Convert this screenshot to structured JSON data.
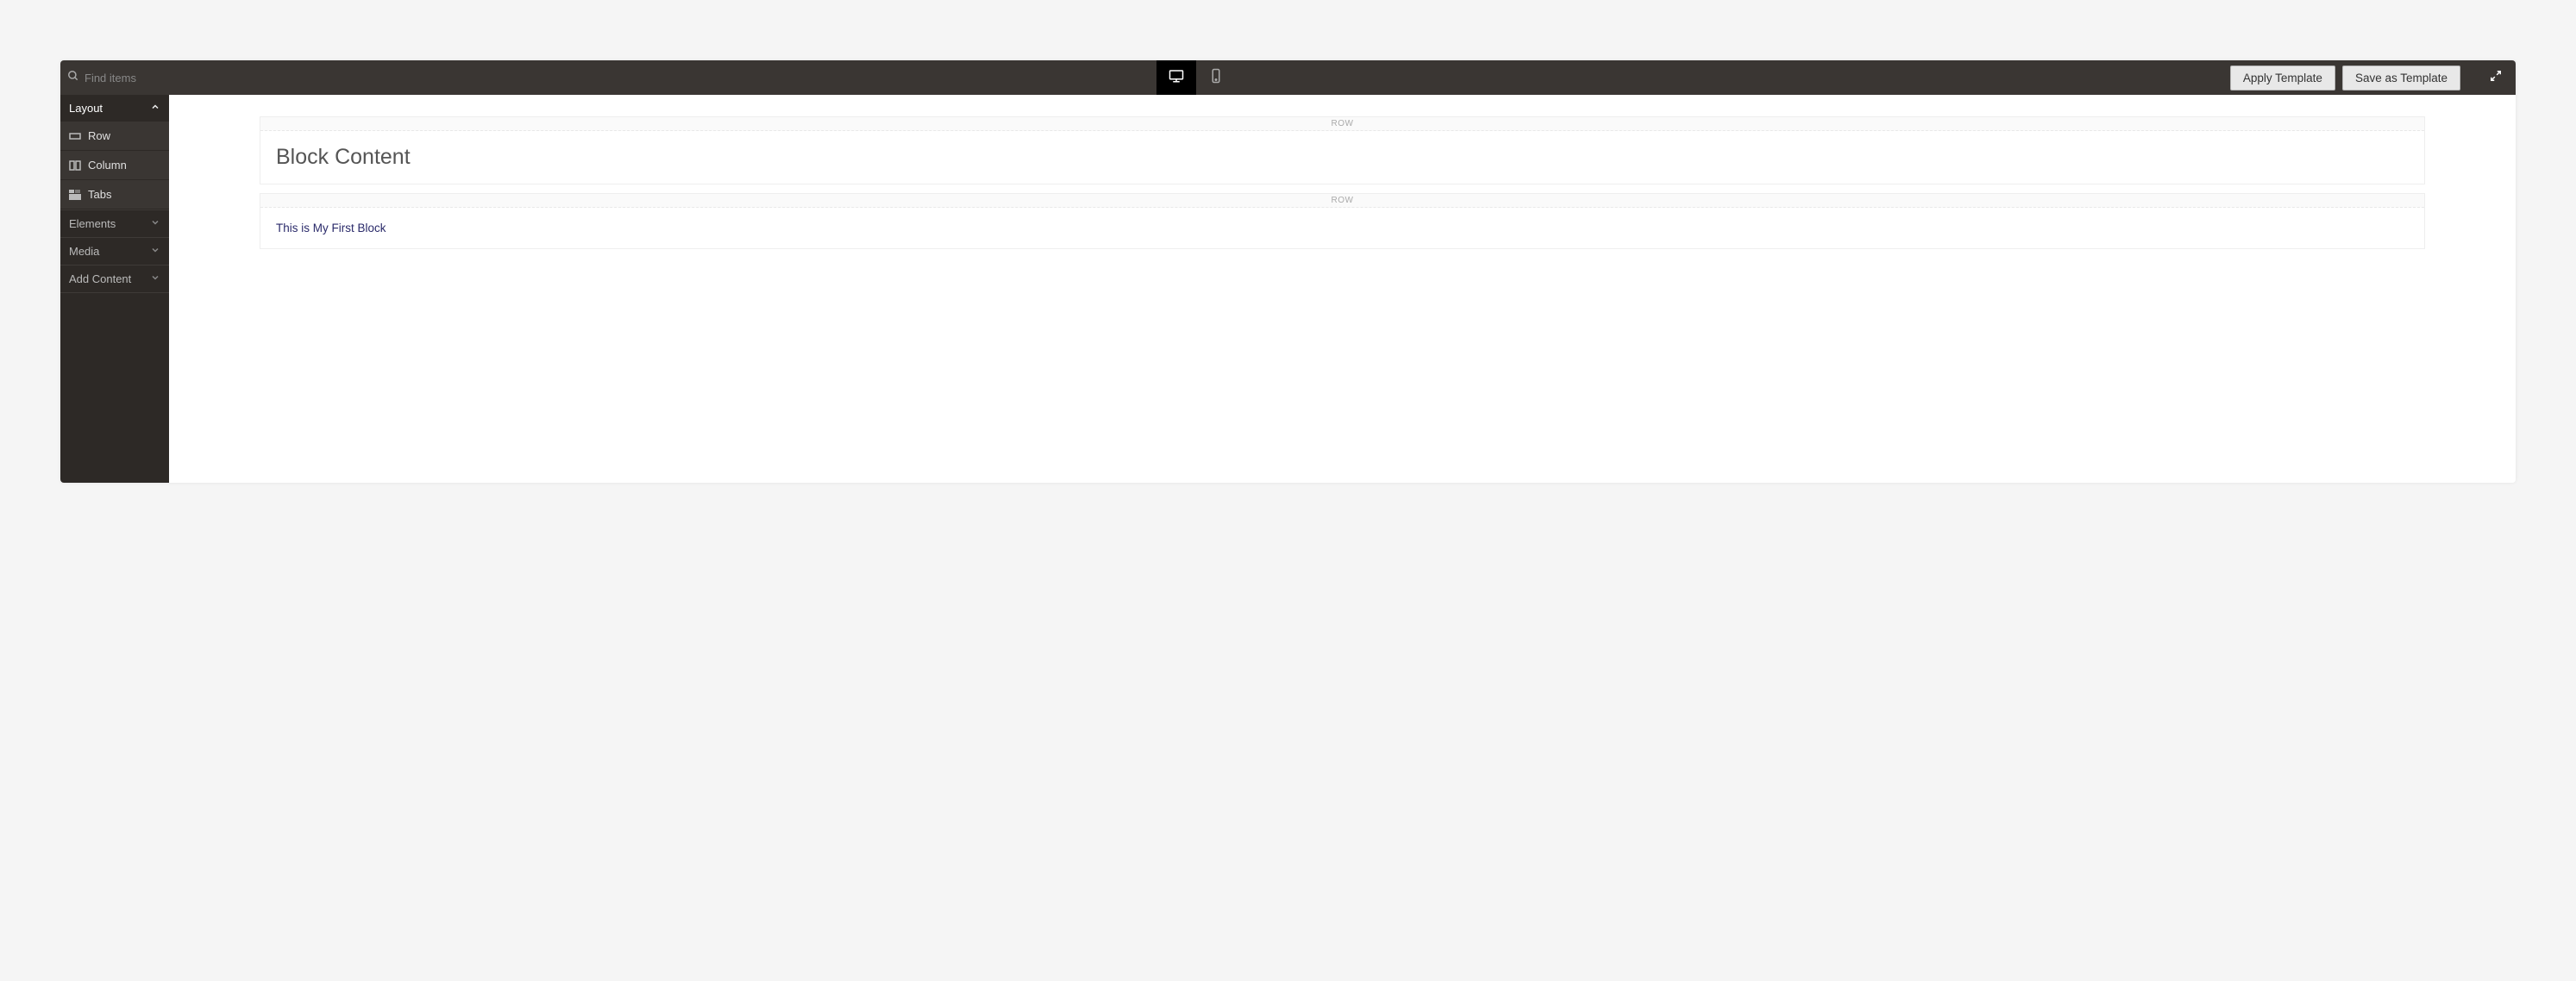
{
  "search": {
    "placeholder": "Find items"
  },
  "toolbar": {
    "apply_template_label": "Apply Template",
    "save_template_label": "Save as Template"
  },
  "sidebar": {
    "sections": [
      {
        "label": "Layout",
        "expanded": true
      },
      {
        "label": "Elements",
        "expanded": false
      },
      {
        "label": "Media",
        "expanded": false
      },
      {
        "label": "Add Content",
        "expanded": false
      }
    ],
    "layout_{": {},
    "layout_items": [
      {
        "label": "Row"
      },
      {
        "label": "Column"
      },
      {
        "label": "Tabs"
      }
    ]
  },
  "canvas": {
    "rows": [
      {
        "label": "ROW",
        "heading": "Block Content"
      },
      {
        "label": "ROW",
        "body": "This is My First Block"
      }
    ]
  }
}
